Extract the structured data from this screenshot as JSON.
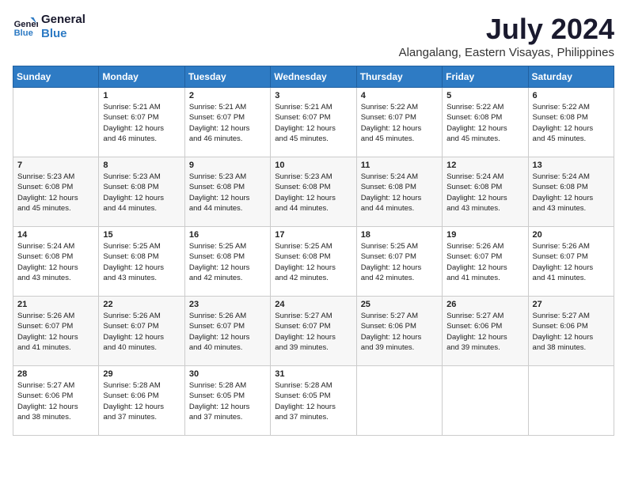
{
  "logo": {
    "line1": "General",
    "line2": "Blue"
  },
  "title": "July 2024",
  "location": "Alangalang, Eastern Visayas, Philippines",
  "weekdays": [
    "Sunday",
    "Monday",
    "Tuesday",
    "Wednesday",
    "Thursday",
    "Friday",
    "Saturday"
  ],
  "weeks": [
    [
      {
        "day": "",
        "info": ""
      },
      {
        "day": "1",
        "info": "Sunrise: 5:21 AM\nSunset: 6:07 PM\nDaylight: 12 hours\nand 46 minutes."
      },
      {
        "day": "2",
        "info": "Sunrise: 5:21 AM\nSunset: 6:07 PM\nDaylight: 12 hours\nand 46 minutes."
      },
      {
        "day": "3",
        "info": "Sunrise: 5:21 AM\nSunset: 6:07 PM\nDaylight: 12 hours\nand 45 minutes."
      },
      {
        "day": "4",
        "info": "Sunrise: 5:22 AM\nSunset: 6:07 PM\nDaylight: 12 hours\nand 45 minutes."
      },
      {
        "day": "5",
        "info": "Sunrise: 5:22 AM\nSunset: 6:08 PM\nDaylight: 12 hours\nand 45 minutes."
      },
      {
        "day": "6",
        "info": "Sunrise: 5:22 AM\nSunset: 6:08 PM\nDaylight: 12 hours\nand 45 minutes."
      }
    ],
    [
      {
        "day": "7",
        "info": "Sunrise: 5:23 AM\nSunset: 6:08 PM\nDaylight: 12 hours\nand 45 minutes."
      },
      {
        "day": "8",
        "info": "Sunrise: 5:23 AM\nSunset: 6:08 PM\nDaylight: 12 hours\nand 44 minutes."
      },
      {
        "day": "9",
        "info": "Sunrise: 5:23 AM\nSunset: 6:08 PM\nDaylight: 12 hours\nand 44 minutes."
      },
      {
        "day": "10",
        "info": "Sunrise: 5:23 AM\nSunset: 6:08 PM\nDaylight: 12 hours\nand 44 minutes."
      },
      {
        "day": "11",
        "info": "Sunrise: 5:24 AM\nSunset: 6:08 PM\nDaylight: 12 hours\nand 44 minutes."
      },
      {
        "day": "12",
        "info": "Sunrise: 5:24 AM\nSunset: 6:08 PM\nDaylight: 12 hours\nand 43 minutes."
      },
      {
        "day": "13",
        "info": "Sunrise: 5:24 AM\nSunset: 6:08 PM\nDaylight: 12 hours\nand 43 minutes."
      }
    ],
    [
      {
        "day": "14",
        "info": "Sunrise: 5:24 AM\nSunset: 6:08 PM\nDaylight: 12 hours\nand 43 minutes."
      },
      {
        "day": "15",
        "info": "Sunrise: 5:25 AM\nSunset: 6:08 PM\nDaylight: 12 hours\nand 43 minutes."
      },
      {
        "day": "16",
        "info": "Sunrise: 5:25 AM\nSunset: 6:08 PM\nDaylight: 12 hours\nand 42 minutes."
      },
      {
        "day": "17",
        "info": "Sunrise: 5:25 AM\nSunset: 6:08 PM\nDaylight: 12 hours\nand 42 minutes."
      },
      {
        "day": "18",
        "info": "Sunrise: 5:25 AM\nSunset: 6:07 PM\nDaylight: 12 hours\nand 42 minutes."
      },
      {
        "day": "19",
        "info": "Sunrise: 5:26 AM\nSunset: 6:07 PM\nDaylight: 12 hours\nand 41 minutes."
      },
      {
        "day": "20",
        "info": "Sunrise: 5:26 AM\nSunset: 6:07 PM\nDaylight: 12 hours\nand 41 minutes."
      }
    ],
    [
      {
        "day": "21",
        "info": "Sunrise: 5:26 AM\nSunset: 6:07 PM\nDaylight: 12 hours\nand 41 minutes."
      },
      {
        "day": "22",
        "info": "Sunrise: 5:26 AM\nSunset: 6:07 PM\nDaylight: 12 hours\nand 40 minutes."
      },
      {
        "day": "23",
        "info": "Sunrise: 5:26 AM\nSunset: 6:07 PM\nDaylight: 12 hours\nand 40 minutes."
      },
      {
        "day": "24",
        "info": "Sunrise: 5:27 AM\nSunset: 6:07 PM\nDaylight: 12 hours\nand 39 minutes."
      },
      {
        "day": "25",
        "info": "Sunrise: 5:27 AM\nSunset: 6:06 PM\nDaylight: 12 hours\nand 39 minutes."
      },
      {
        "day": "26",
        "info": "Sunrise: 5:27 AM\nSunset: 6:06 PM\nDaylight: 12 hours\nand 39 minutes."
      },
      {
        "day": "27",
        "info": "Sunrise: 5:27 AM\nSunset: 6:06 PM\nDaylight: 12 hours\nand 38 minutes."
      }
    ],
    [
      {
        "day": "28",
        "info": "Sunrise: 5:27 AM\nSunset: 6:06 PM\nDaylight: 12 hours\nand 38 minutes."
      },
      {
        "day": "29",
        "info": "Sunrise: 5:28 AM\nSunset: 6:06 PM\nDaylight: 12 hours\nand 37 minutes."
      },
      {
        "day": "30",
        "info": "Sunrise: 5:28 AM\nSunset: 6:05 PM\nDaylight: 12 hours\nand 37 minutes."
      },
      {
        "day": "31",
        "info": "Sunrise: 5:28 AM\nSunset: 6:05 PM\nDaylight: 12 hours\nand 37 minutes."
      },
      {
        "day": "",
        "info": ""
      },
      {
        "day": "",
        "info": ""
      },
      {
        "day": "",
        "info": ""
      }
    ]
  ]
}
